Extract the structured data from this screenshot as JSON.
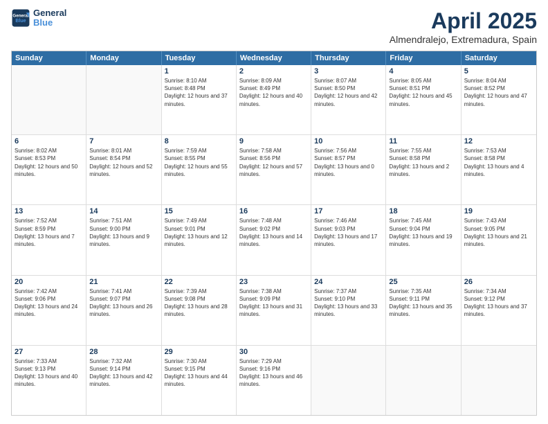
{
  "header": {
    "logo_general": "General",
    "logo_blue": "Blue",
    "title": "April 2025",
    "subtitle": "Almendralejo, Extremadura, Spain"
  },
  "calendar": {
    "days": [
      "Sunday",
      "Monday",
      "Tuesday",
      "Wednesday",
      "Thursday",
      "Friday",
      "Saturday"
    ],
    "rows": [
      [
        {
          "day": "",
          "sunrise": "",
          "sunset": "",
          "daylight": "",
          "empty": true
        },
        {
          "day": "",
          "sunrise": "",
          "sunset": "",
          "daylight": "",
          "empty": true
        },
        {
          "day": "1",
          "sunrise": "Sunrise: 8:10 AM",
          "sunset": "Sunset: 8:48 PM",
          "daylight": "Daylight: 12 hours and 37 minutes.",
          "empty": false
        },
        {
          "day": "2",
          "sunrise": "Sunrise: 8:09 AM",
          "sunset": "Sunset: 8:49 PM",
          "daylight": "Daylight: 12 hours and 40 minutes.",
          "empty": false
        },
        {
          "day": "3",
          "sunrise": "Sunrise: 8:07 AM",
          "sunset": "Sunset: 8:50 PM",
          "daylight": "Daylight: 12 hours and 42 minutes.",
          "empty": false
        },
        {
          "day": "4",
          "sunrise": "Sunrise: 8:05 AM",
          "sunset": "Sunset: 8:51 PM",
          "daylight": "Daylight: 12 hours and 45 minutes.",
          "empty": false
        },
        {
          "day": "5",
          "sunrise": "Sunrise: 8:04 AM",
          "sunset": "Sunset: 8:52 PM",
          "daylight": "Daylight: 12 hours and 47 minutes.",
          "empty": false
        }
      ],
      [
        {
          "day": "6",
          "sunrise": "Sunrise: 8:02 AM",
          "sunset": "Sunset: 8:53 PM",
          "daylight": "Daylight: 12 hours and 50 minutes.",
          "empty": false
        },
        {
          "day": "7",
          "sunrise": "Sunrise: 8:01 AM",
          "sunset": "Sunset: 8:54 PM",
          "daylight": "Daylight: 12 hours and 52 minutes.",
          "empty": false
        },
        {
          "day": "8",
          "sunrise": "Sunrise: 7:59 AM",
          "sunset": "Sunset: 8:55 PM",
          "daylight": "Daylight: 12 hours and 55 minutes.",
          "empty": false
        },
        {
          "day": "9",
          "sunrise": "Sunrise: 7:58 AM",
          "sunset": "Sunset: 8:56 PM",
          "daylight": "Daylight: 12 hours and 57 minutes.",
          "empty": false
        },
        {
          "day": "10",
          "sunrise": "Sunrise: 7:56 AM",
          "sunset": "Sunset: 8:57 PM",
          "daylight": "Daylight: 13 hours and 0 minutes.",
          "empty": false
        },
        {
          "day": "11",
          "sunrise": "Sunrise: 7:55 AM",
          "sunset": "Sunset: 8:58 PM",
          "daylight": "Daylight: 13 hours and 2 minutes.",
          "empty": false
        },
        {
          "day": "12",
          "sunrise": "Sunrise: 7:53 AM",
          "sunset": "Sunset: 8:58 PM",
          "daylight": "Daylight: 13 hours and 4 minutes.",
          "empty": false
        }
      ],
      [
        {
          "day": "13",
          "sunrise": "Sunrise: 7:52 AM",
          "sunset": "Sunset: 8:59 PM",
          "daylight": "Daylight: 13 hours and 7 minutes.",
          "empty": false
        },
        {
          "day": "14",
          "sunrise": "Sunrise: 7:51 AM",
          "sunset": "Sunset: 9:00 PM",
          "daylight": "Daylight: 13 hours and 9 minutes.",
          "empty": false
        },
        {
          "day": "15",
          "sunrise": "Sunrise: 7:49 AM",
          "sunset": "Sunset: 9:01 PM",
          "daylight": "Daylight: 13 hours and 12 minutes.",
          "empty": false
        },
        {
          "day": "16",
          "sunrise": "Sunrise: 7:48 AM",
          "sunset": "Sunset: 9:02 PM",
          "daylight": "Daylight: 13 hours and 14 minutes.",
          "empty": false
        },
        {
          "day": "17",
          "sunrise": "Sunrise: 7:46 AM",
          "sunset": "Sunset: 9:03 PM",
          "daylight": "Daylight: 13 hours and 17 minutes.",
          "empty": false
        },
        {
          "day": "18",
          "sunrise": "Sunrise: 7:45 AM",
          "sunset": "Sunset: 9:04 PM",
          "daylight": "Daylight: 13 hours and 19 minutes.",
          "empty": false
        },
        {
          "day": "19",
          "sunrise": "Sunrise: 7:43 AM",
          "sunset": "Sunset: 9:05 PM",
          "daylight": "Daylight: 13 hours and 21 minutes.",
          "empty": false
        }
      ],
      [
        {
          "day": "20",
          "sunrise": "Sunrise: 7:42 AM",
          "sunset": "Sunset: 9:06 PM",
          "daylight": "Daylight: 13 hours and 24 minutes.",
          "empty": false
        },
        {
          "day": "21",
          "sunrise": "Sunrise: 7:41 AM",
          "sunset": "Sunset: 9:07 PM",
          "daylight": "Daylight: 13 hours and 26 minutes.",
          "empty": false
        },
        {
          "day": "22",
          "sunrise": "Sunrise: 7:39 AM",
          "sunset": "Sunset: 9:08 PM",
          "daylight": "Daylight: 13 hours and 28 minutes.",
          "empty": false
        },
        {
          "day": "23",
          "sunrise": "Sunrise: 7:38 AM",
          "sunset": "Sunset: 9:09 PM",
          "daylight": "Daylight: 13 hours and 31 minutes.",
          "empty": false
        },
        {
          "day": "24",
          "sunrise": "Sunrise: 7:37 AM",
          "sunset": "Sunset: 9:10 PM",
          "daylight": "Daylight: 13 hours and 33 minutes.",
          "empty": false
        },
        {
          "day": "25",
          "sunrise": "Sunrise: 7:35 AM",
          "sunset": "Sunset: 9:11 PM",
          "daylight": "Daylight: 13 hours and 35 minutes.",
          "empty": false
        },
        {
          "day": "26",
          "sunrise": "Sunrise: 7:34 AM",
          "sunset": "Sunset: 9:12 PM",
          "daylight": "Daylight: 13 hours and 37 minutes.",
          "empty": false
        }
      ],
      [
        {
          "day": "27",
          "sunrise": "Sunrise: 7:33 AM",
          "sunset": "Sunset: 9:13 PM",
          "daylight": "Daylight: 13 hours and 40 minutes.",
          "empty": false
        },
        {
          "day": "28",
          "sunrise": "Sunrise: 7:32 AM",
          "sunset": "Sunset: 9:14 PM",
          "daylight": "Daylight: 13 hours and 42 minutes.",
          "empty": false
        },
        {
          "day": "29",
          "sunrise": "Sunrise: 7:30 AM",
          "sunset": "Sunset: 9:15 PM",
          "daylight": "Daylight: 13 hours and 44 minutes.",
          "empty": false
        },
        {
          "day": "30",
          "sunrise": "Sunrise: 7:29 AM",
          "sunset": "Sunset: 9:16 PM",
          "daylight": "Daylight: 13 hours and 46 minutes.",
          "empty": false
        },
        {
          "day": "",
          "sunrise": "",
          "sunset": "",
          "daylight": "",
          "empty": true
        },
        {
          "day": "",
          "sunrise": "",
          "sunset": "",
          "daylight": "",
          "empty": true
        },
        {
          "day": "",
          "sunrise": "",
          "sunset": "",
          "daylight": "",
          "empty": true
        }
      ]
    ]
  }
}
